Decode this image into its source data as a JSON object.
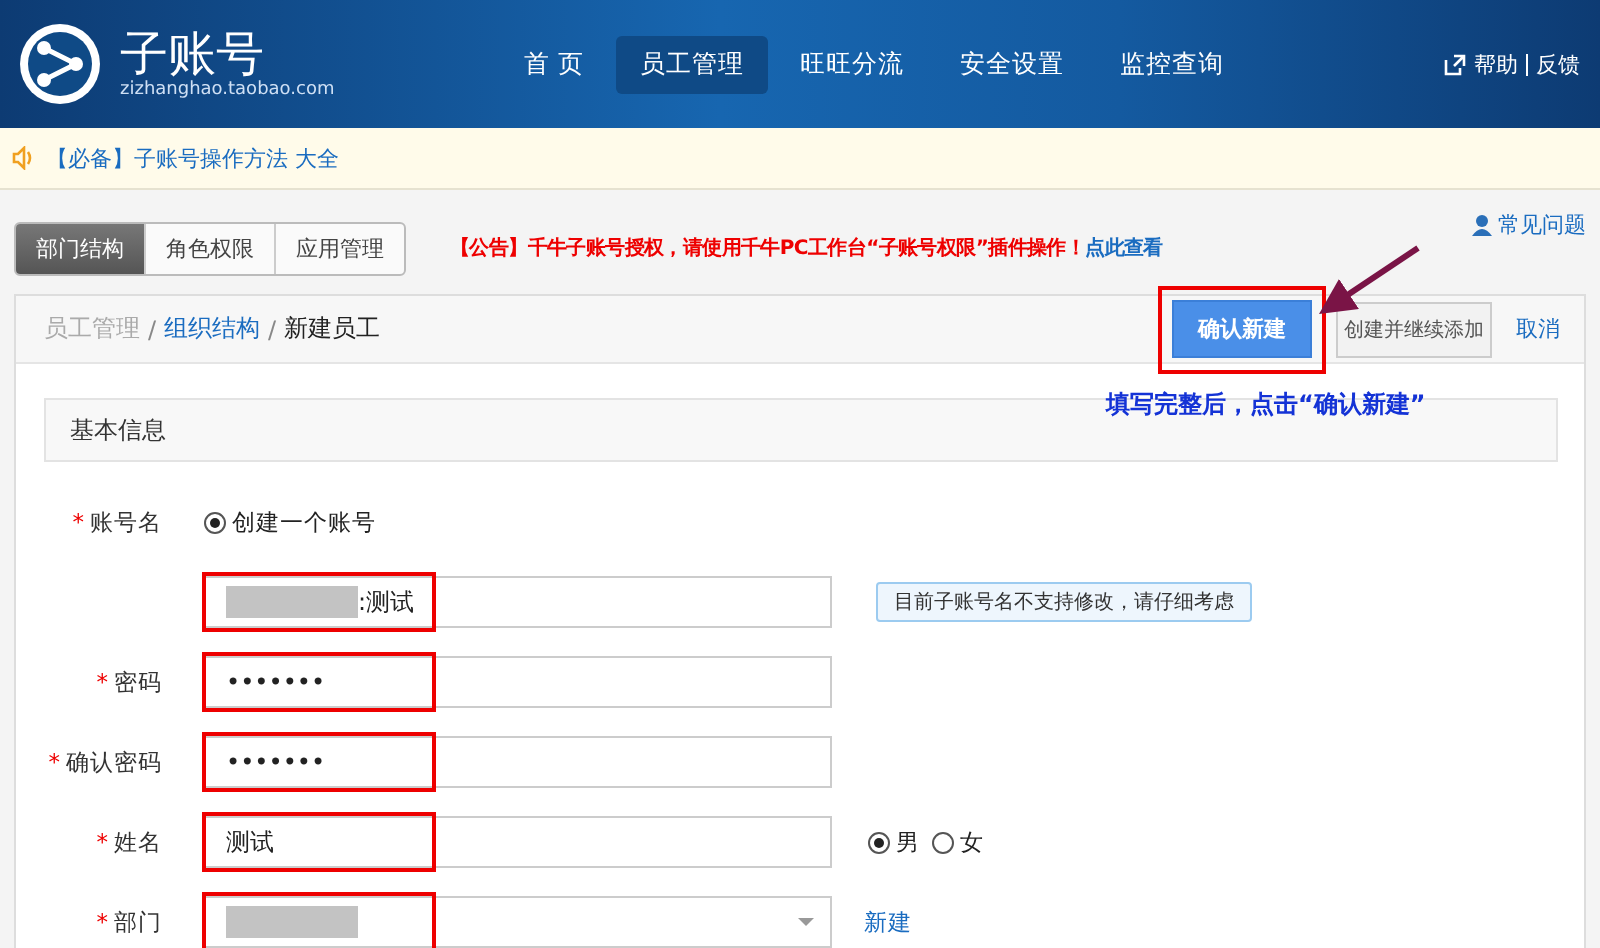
{
  "header": {
    "logo_title": "子账号",
    "logo_subtitle": "zizhanghao.taobao.com",
    "nav": [
      {
        "label": "首 页",
        "selected": false
      },
      {
        "label": "员工管理",
        "selected": true
      },
      {
        "label": "旺旺分流",
        "selected": false
      },
      {
        "label": "安全设置",
        "selected": false
      },
      {
        "label": "监控查询",
        "selected": false
      }
    ],
    "links": [
      "帮助",
      "反馈"
    ]
  },
  "notice": {
    "text": "【必备】子账号操作方法 大全"
  },
  "tabs": [
    {
      "label": "部门结构",
      "selected": true
    },
    {
      "label": "角色权限",
      "selected": false
    },
    {
      "label": "应用管理",
      "selected": false
    }
  ],
  "announcement": {
    "text": "【公告】千牛子账号授权，请使用千牛PC工作台“子账号权限”插件操作！",
    "link": "点此查看"
  },
  "help_link": "常见问题",
  "breadcrumb": [
    "员工管理",
    "组织结构",
    "新建员工"
  ],
  "breadcrumb_separator": "/",
  "buttons": {
    "confirm": "确认新建",
    "continue": "创建并继续添加",
    "cancel": "取消"
  },
  "annotation": "填写完整后，点击“确认新建”",
  "section_title": "基本信息",
  "required_mark": "*",
  "fields": [
    {
      "kind": "radio",
      "label": "账号名",
      "required": true,
      "options": [
        {
          "label": "创建一个账号",
          "selected": true
        }
      ]
    },
    {
      "kind": "text",
      "value": ":测试",
      "redacted": true,
      "highlighted": true,
      "tip": "目前子账号名不支持修改，请仔细考虑"
    },
    {
      "kind": "text",
      "label": "密码",
      "required": true,
      "value": "•••••••",
      "highlighted": true
    },
    {
      "kind": "text",
      "label": "确认密码",
      "required": true,
      "value": "•••••••",
      "highlighted": true
    },
    {
      "kind": "text",
      "label": "姓名",
      "required": true,
      "value": "测试",
      "highlighted": true,
      "options": [
        {
          "label": "男",
          "selected": true
        },
        {
          "label": "女",
          "selected": false
        }
      ]
    },
    {
      "kind": "select",
      "label": "部门",
      "required": true,
      "redacted": true,
      "highlighted": true,
      "link": "新建"
    }
  ]
}
